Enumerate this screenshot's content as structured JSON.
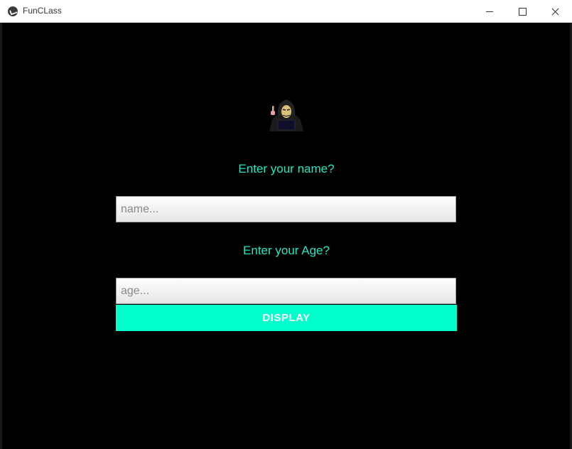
{
  "window": {
    "title": "FunCLass",
    "icon": "kivy-logo-icon"
  },
  "form": {
    "logo_icon": "hooded-hacker-icon",
    "name_label": "Enter your name?",
    "name_placeholder": "name...",
    "name_value": "",
    "age_label": "Enter your Age?",
    "age_placeholder": "age...",
    "age_value": "",
    "display_label": "DISPLAY"
  },
  "colors": {
    "background": "#000000",
    "accent": "#00ffcc",
    "label_text": "#1de8c4"
  }
}
